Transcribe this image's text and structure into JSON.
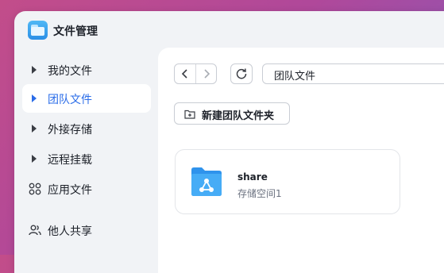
{
  "app": {
    "title": "文件管理"
  },
  "sidebar": {
    "items": [
      {
        "label": "我的文件",
        "kind": "expandable"
      },
      {
        "label": "团队文件",
        "kind": "expandable",
        "active": true
      },
      {
        "label": "外接存储",
        "kind": "expandable"
      },
      {
        "label": "远程挂载",
        "kind": "expandable"
      },
      {
        "label": "应用文件",
        "kind": "icon",
        "icon": "apps-grid-icon"
      },
      {
        "label": "他人共享",
        "kind": "icon",
        "icon": "users-icon"
      }
    ]
  },
  "toolbar": {
    "path": "团队文件",
    "new_folder_label": "新建团队文件夹"
  },
  "files": [
    {
      "name": "share",
      "subtitle": "存储空间1",
      "icon": "shared-folder-icon"
    }
  ],
  "colors": {
    "accent": "#2a6ce8",
    "folder": "#3ea4f4"
  }
}
